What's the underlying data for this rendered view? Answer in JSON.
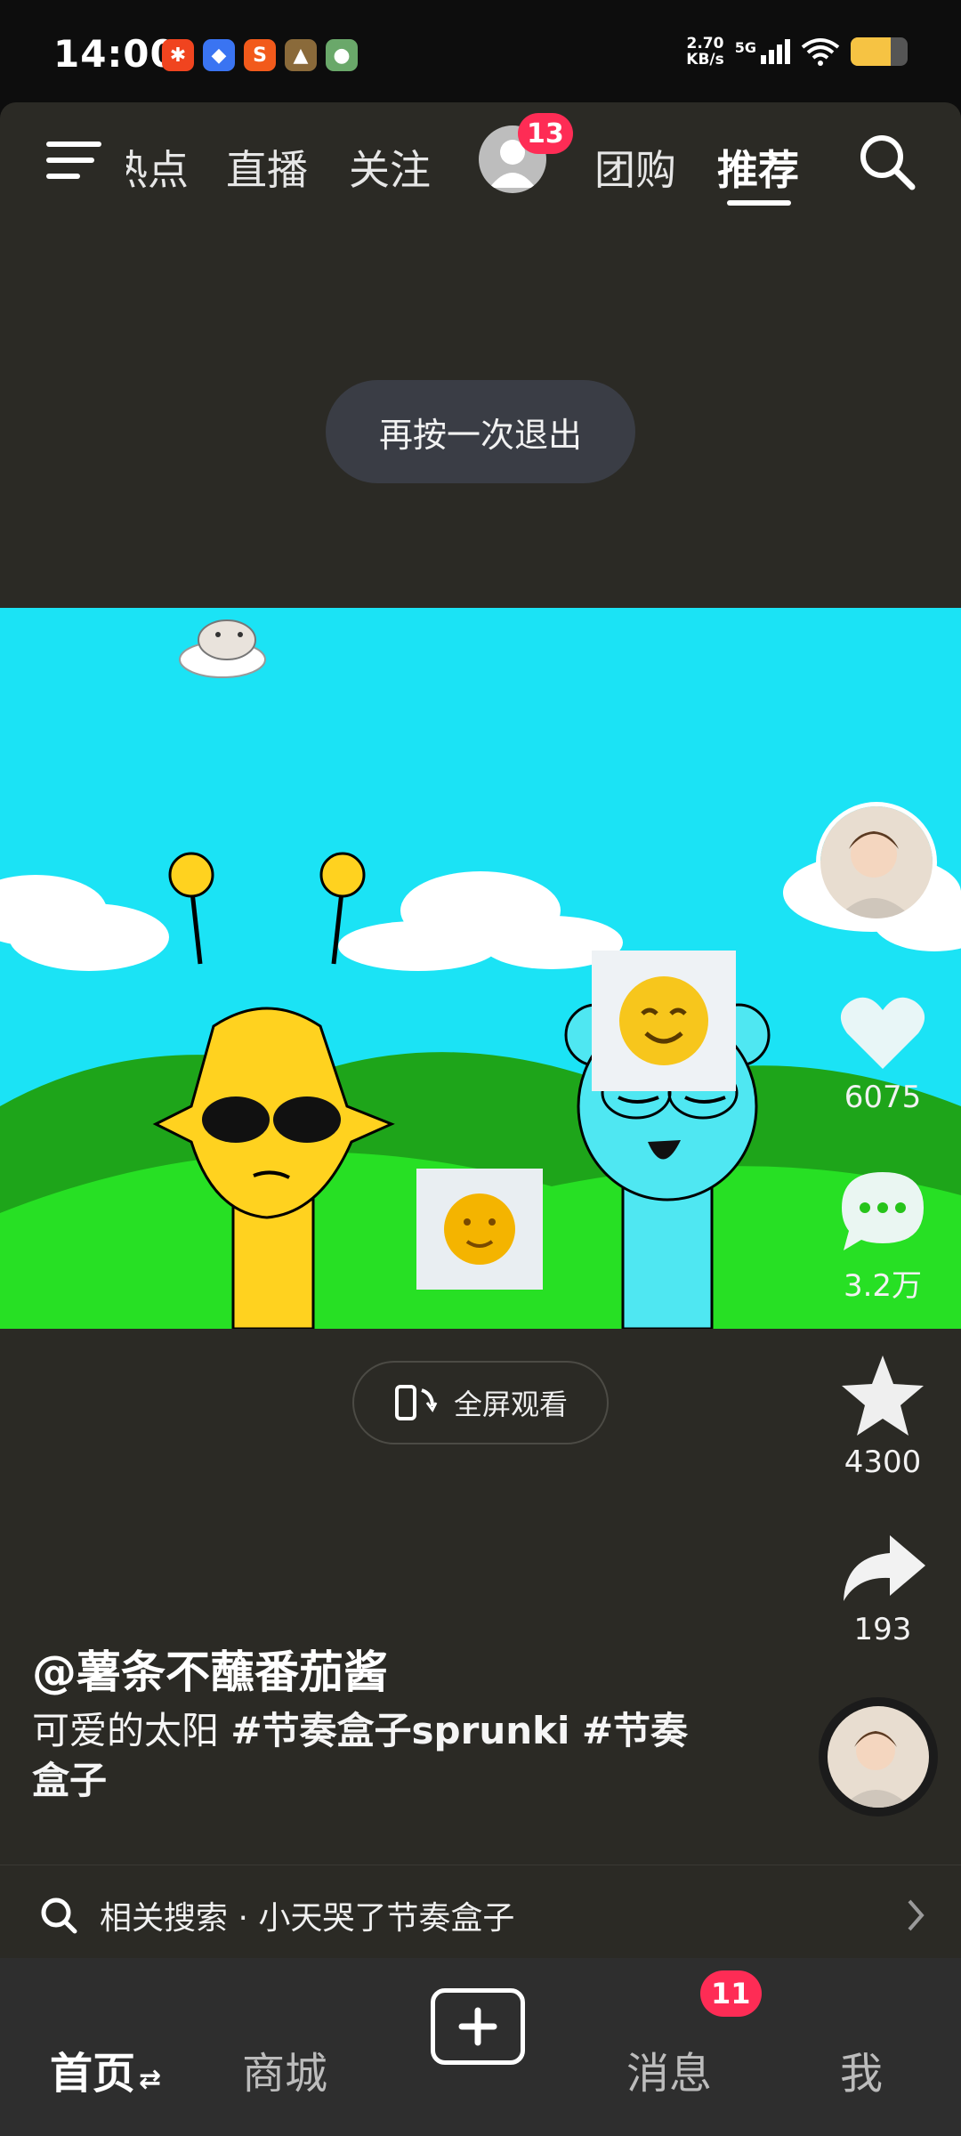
{
  "status_bar": {
    "time": "14:00",
    "net_speed_value": "2.70",
    "net_speed_unit": "KB/s",
    "signal_label": "5G",
    "battery_level": 0.7,
    "app_icons": [
      "xiaohongshu-icon",
      "blue-app-icon",
      "sogou-input-icon",
      "game-app-icon",
      "game-app-icon-2"
    ],
    "colors": {
      "battery": "#f6c343"
    }
  },
  "top_nav": {
    "tabs": [
      {
        "label": "热点"
      },
      {
        "label": "直播"
      },
      {
        "label": "关注"
      },
      {
        "label": "团购"
      },
      {
        "label": "推荐"
      }
    ],
    "active_tab": "推荐",
    "avatar_badge": "13"
  },
  "toast": {
    "text": "再按一次退出"
  },
  "video_actions": {
    "like_count": "6075",
    "comment_count": "3.2万",
    "favorite_count": "4300",
    "share_count": "193"
  },
  "fullscreen": {
    "label": "全屏观看"
  },
  "post": {
    "author": "@薯条不蘸番茄酱",
    "caption_plain": "可爱的太阳 ",
    "hashtag_1": "#节奏盒子sprunki",
    "hashtag_2": "#节奏盒子"
  },
  "related_search": {
    "text": "相关搜索 · 小天哭了节奏盒子"
  },
  "bottom_nav": {
    "home": "首页",
    "mall": "商城",
    "messages": "消息",
    "me": "我",
    "messages_badge": "11"
  },
  "colors": {
    "app_bg": "#2b2a25",
    "badge": "#fe2c55",
    "sky": "#1be3f5",
    "grass": "#27c41b"
  }
}
